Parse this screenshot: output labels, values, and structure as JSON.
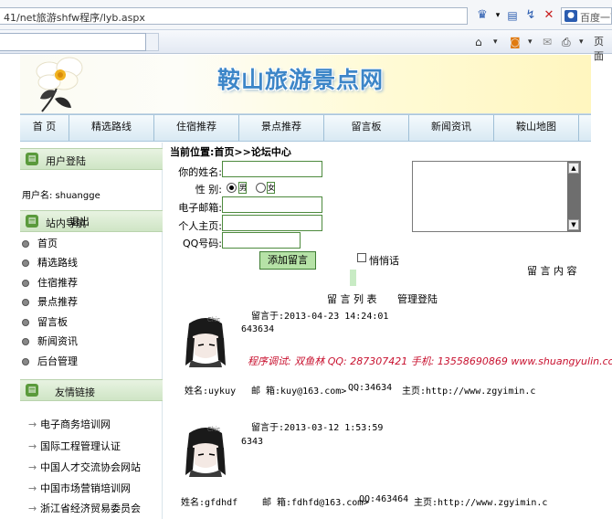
{
  "browser": {
    "url": "41/net旅游shfw程序/lyb.aspx",
    "search_placeholder": "百度一下"
  },
  "site": {
    "title": "鞍山旅游景点网"
  },
  "nav": {
    "items": [
      "首 页",
      "精选路线",
      "住宿推荐",
      "景点推荐",
      "留言板",
      "新闻资讯",
      "鞍山地图"
    ]
  },
  "sidebar": {
    "login_title": "用户登陆",
    "username_line": "用户名: shuangge",
    "guide_title": "站内导航",
    "guide_overlay": "退出",
    "nav_items": [
      "首页",
      "精选路线",
      "住宿推荐",
      "景点推荐",
      "留言板",
      "新闻资讯",
      "后台管理"
    ],
    "links_title": "友情链接",
    "links": [
      "电子商务培训网",
      "国际工程管理认证",
      "中国人才交流协会网站",
      "中国市场营销培训网",
      "浙江省经济贸易委员会"
    ]
  },
  "main": {
    "breadcrumb": "当前位置:首页>>论坛中心",
    "form": {
      "name_label": "你的姓名:",
      "gender_label": "性  别:",
      "male": "男",
      "female": "女",
      "email_label": "电子邮箱:",
      "homepage_label": "个人主页:",
      "qq_label": "QQ号码:",
      "submit": "添加留言",
      "secret": "悄悄话",
      "content_label": "留 言 内 容"
    },
    "list_title": "留 言 列 表",
    "admin_link": "管理登陆",
    "messages": [
      {
        "time": "留言于:2013-04-23 14:24:01",
        "content": "643634",
        "promo": "程序调试: 双鱼林   QQ: 287307421   手机: 13558690869   www.shuangyulin.com",
        "name": "姓名:uykuy",
        "email": "邮 箱:kuy@163.com>",
        "qq": "QQ:34634",
        "homepage": "主页:http://www.zgyimin.c"
      },
      {
        "time": "留言于:2013-03-12 1:53:59",
        "content": "6343",
        "name": "姓名:gfdhdf",
        "email": "邮 箱:fdhfd@163.com>",
        "qq": "QQ:463464",
        "homepage": "主页:http://www.zgyimin.c"
      }
    ]
  }
}
